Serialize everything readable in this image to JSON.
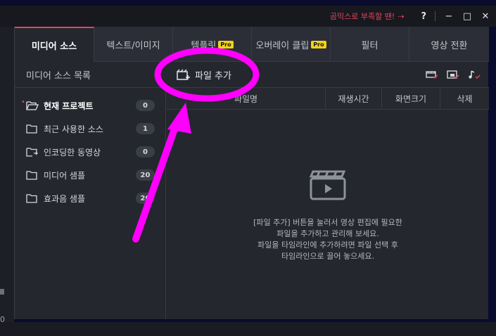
{
  "titlebar": {
    "promo_text": "곰믹스로 부족할 땐!",
    "promo_arrow": "⇢",
    "help": "?",
    "minimize": "−",
    "maximize": "□",
    "close": "✕"
  },
  "left_strip": {
    "digit": "0"
  },
  "tabs": [
    {
      "label": "미디어 소스",
      "pro": ""
    },
    {
      "label": "텍스트/이미지",
      "pro": ""
    },
    {
      "label": "템플릿",
      "pro": "Pro"
    },
    {
      "label": "오버레이 클립",
      "pro": "Pro"
    },
    {
      "label": "필터",
      "pro": ""
    },
    {
      "label": "영상 전환",
      "pro": ""
    }
  ],
  "subheader": {
    "title": "미디어 소스 목록",
    "add_file": "파일 추가"
  },
  "sidebar": {
    "items": [
      {
        "label": "현재 프로젝트",
        "count": "0"
      },
      {
        "label": "최근 사용한 소스",
        "count": "1"
      },
      {
        "label": "인코딩한 동영상",
        "count": "0"
      },
      {
        "label": "미디어 샘플",
        "count": "20"
      },
      {
        "label": "효과음 샘플",
        "count": "20"
      }
    ]
  },
  "columns": {
    "filename": "파일명",
    "duration": "재생시간",
    "resolution": "화면크기",
    "delete": "삭제"
  },
  "empty_message": {
    "line1": "[파일 추가] 버튼을 눌러서 영상 편집에 필요한",
    "line2": "파일을 추가하고 관리해 보세요.",
    "line3": "파일을 타임라인에 추가하려면 파일 선택 후",
    "line4": "타임라인으로 끌어 놓으세요."
  },
  "colors": {
    "accent": "#e8435a",
    "annotation": "#ff00ff",
    "pro_badge": "#f3d316"
  }
}
